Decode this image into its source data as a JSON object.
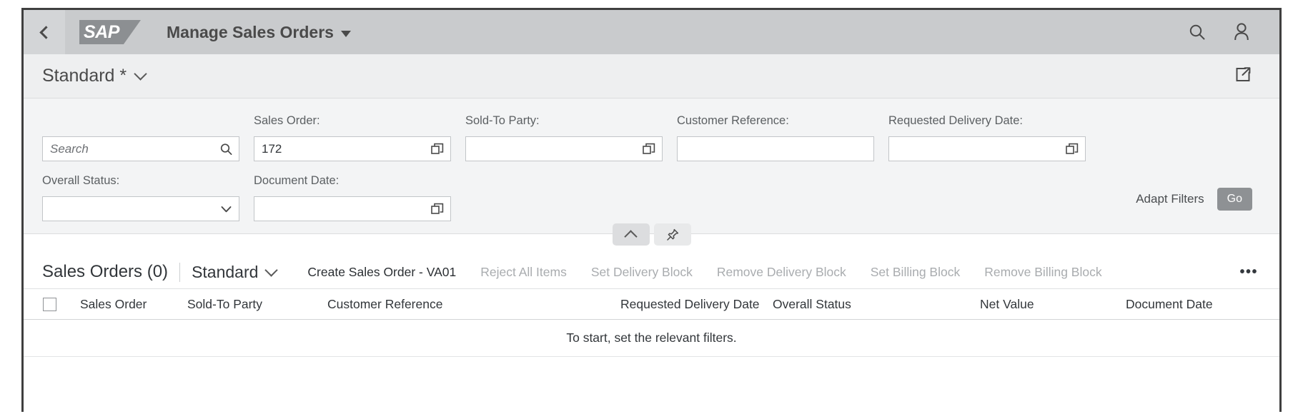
{
  "shell": {
    "back_icon": "back-chevron-icon",
    "logo_text": "SAP",
    "app_title": "Manage Sales Orders",
    "search_icon": "search-icon",
    "user_icon": "user-avatar-icon"
  },
  "variant": {
    "title": "Standard *",
    "chevron_icon": "chevron-down-icon",
    "share_icon": "share-export-icon"
  },
  "filters": {
    "search": {
      "label": "",
      "value": "",
      "placeholder": "Search",
      "icon": "search-icon"
    },
    "fields": [
      {
        "label": "Sales Order:",
        "value": "172",
        "placeholder": "",
        "icon": "value-help-icon"
      },
      {
        "label": "Sold-To Party:",
        "value": "",
        "placeholder": "",
        "icon": "value-help-icon"
      },
      {
        "label": "Customer Reference:",
        "value": "",
        "placeholder": "",
        "icon": "none"
      },
      {
        "label": "Requested Delivery Date:",
        "value": "",
        "placeholder": "",
        "icon": "value-help-icon"
      },
      {
        "label": "Overall Status:",
        "value": "",
        "placeholder": "",
        "icon": "chevron-down-icon"
      },
      {
        "label": "Document Date:",
        "value": "",
        "placeholder": "",
        "icon": "value-help-icon"
      }
    ],
    "adapt_filters_label": "Adapt Filters",
    "go_label": "Go",
    "collapse_icon": "chevron-up-icon",
    "pin_icon": "pin-icon"
  },
  "table": {
    "title": "Sales Orders (0)",
    "variant_label": "Standard",
    "variant_chevron_icon": "chevron-down-icon",
    "overflow_icon": "overflow-dots-icon",
    "overflow_label": "•••",
    "actions": [
      {
        "label": "Create Sales Order - VA01",
        "enabled": true
      },
      {
        "label": "Reject All Items",
        "enabled": false
      },
      {
        "label": "Set Delivery Block",
        "enabled": false
      },
      {
        "label": "Remove Delivery Block",
        "enabled": false
      },
      {
        "label": "Set Billing Block",
        "enabled": false
      },
      {
        "label": "Remove Billing Block",
        "enabled": false
      }
    ],
    "select_all_icon": "checkbox-unchecked-icon",
    "columns": [
      "Sales Order",
      "Sold-To Party",
      "Customer Reference",
      "Requested Delivery Date",
      "Overall Status",
      "Net Value",
      "Document Date"
    ],
    "empty_message": "To start, set the relevant filters.",
    "rows": []
  },
  "colors": {
    "shell_bg": "#c9cbcd",
    "variant_bg": "#eeeff0",
    "filter_bg": "#f3f4f5",
    "go_button": "#8e9194",
    "text_primary": "#32363a",
    "text_disabled": "#a9acaf"
  }
}
